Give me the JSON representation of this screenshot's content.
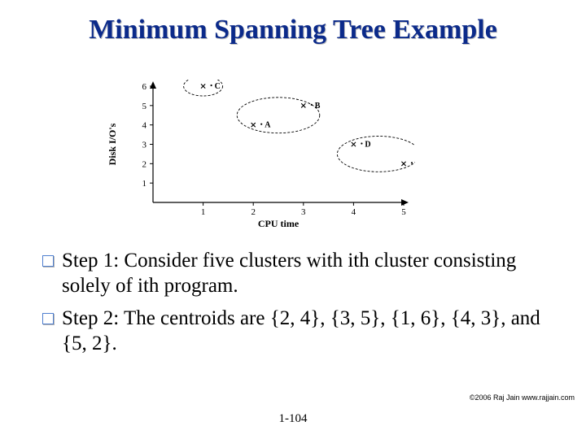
{
  "title": "Minimum Spanning Tree Example",
  "bullets": [
    "Step 1: Consider five clusters with ith cluster consisting solely of ith program.",
    "Step 2: The centroids are {2, 4}, {3, 5}, {1, 6}, {4, 3}, and {5, 2}."
  ],
  "copyright": "©2006 Raj Jain www.rajjain.com",
  "slidenum": "1-104",
  "chart_data": {
    "type": "scatter",
    "xlabel": "CPU time",
    "ylabel": "Disk I/O's",
    "xlim": [
      0,
      5
    ],
    "ylim": [
      0,
      6
    ],
    "xticks": [
      1,
      2,
      3,
      4,
      5
    ],
    "yticks": [
      1,
      2,
      3,
      4,
      5,
      6
    ],
    "points": [
      {
        "name": "A",
        "x": 2,
        "y": 4
      },
      {
        "name": "B",
        "x": 3,
        "y": 5
      },
      {
        "name": "C",
        "x": 1,
        "y": 6
      },
      {
        "name": "D",
        "x": 4,
        "y": 3
      },
      {
        "name": "E",
        "x": 5,
        "y": 2
      }
    ],
    "clusters": [
      {
        "members": [
          "C"
        ]
      },
      {
        "members": [
          "A",
          "B"
        ]
      },
      {
        "members": [
          "D",
          "E"
        ]
      }
    ],
    "marker": "x"
  }
}
